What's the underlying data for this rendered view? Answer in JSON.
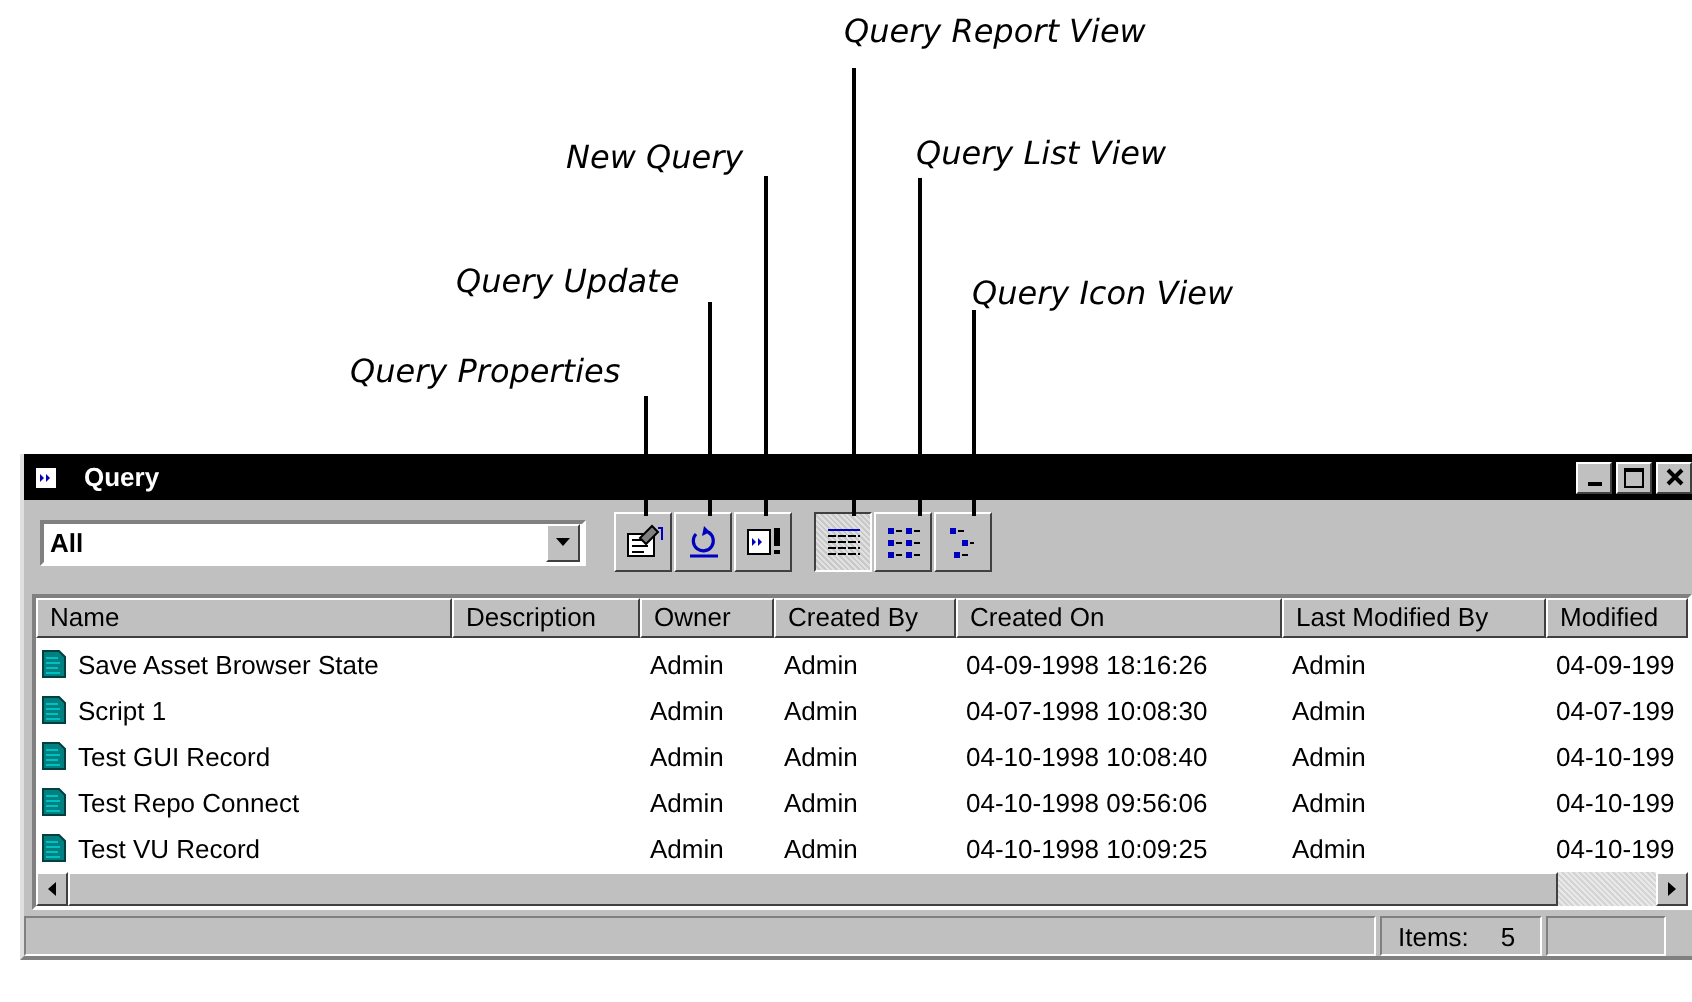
{
  "callouts": [
    {
      "label": "Query Report View"
    },
    {
      "label": "New Query"
    },
    {
      "label": "Query List View"
    },
    {
      "label": "Query Update"
    },
    {
      "label": "Query Icon View"
    },
    {
      "label": "Query Properties"
    }
  ],
  "window": {
    "title": "Query"
  },
  "toolbar": {
    "filter": {
      "value": "All"
    },
    "buttons": [
      {
        "kind": "properties",
        "selected": false
      },
      {
        "kind": "update",
        "selected": false
      },
      {
        "kind": "new",
        "selected": false
      },
      {
        "kind": "report",
        "selected": true
      },
      {
        "kind": "list",
        "selected": false
      },
      {
        "kind": "icon",
        "selected": false
      }
    ]
  },
  "table": {
    "columns": [
      "Name",
      "Description",
      "Owner",
      "Created By",
      "Created On",
      "Last Modified By",
      "Modified"
    ],
    "rows": [
      [
        "Save Asset Browser State",
        "",
        "Admin",
        "Admin",
        "04-09-1998 18:16:26",
        "Admin",
        "04-09-199"
      ],
      [
        "Script 1",
        "",
        "Admin",
        "Admin",
        "04-07-1998 10:08:30",
        "Admin",
        "04-07-199"
      ],
      [
        "Test GUI Record",
        "",
        "Admin",
        "Admin",
        "04-10-1998 10:08:40",
        "Admin",
        "04-10-199"
      ],
      [
        "Test Repo Connect",
        "",
        "Admin",
        "Admin",
        "04-10-1998 09:56:06",
        "Admin",
        "04-10-199"
      ],
      [
        "Test VU Record",
        "",
        "Admin",
        "Admin",
        "04-10-1998 10:09:25",
        "Admin",
        "04-10-199"
      ]
    ]
  },
  "status_bar": {
    "items_label": "Items:",
    "items_count": "5"
  }
}
